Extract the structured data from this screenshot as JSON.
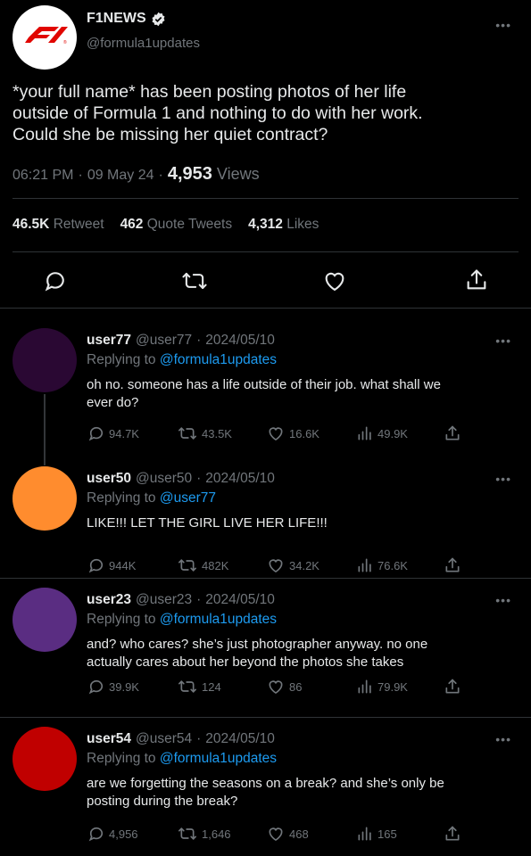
{
  "tweet": {
    "account_name": "F1NEWS",
    "handle": "@formula1updates",
    "text_line1": "*your full name* has been posting photos of her life",
    "text_line2": "outside of Formula 1 and nothing to do with her work.",
    "text_line3": "Could she be missing her quiet contract?",
    "time": "06:21 PM",
    "date": "09 May 24",
    "views_count": "4,953",
    "views_label": "Views",
    "retweets_count": "46.5K",
    "retweets_label": "Retweet",
    "quotes_count": "462",
    "quotes_label": "Quote Tweets",
    "likes_count": "4,312",
    "likes_label": "Likes",
    "sep": "·"
  },
  "replying_to_label": "Replying to",
  "replies": [
    {
      "username": "user77",
      "handle": "@user77",
      "date": "2024/05/10",
      "reply_to": "@formula1updates",
      "text_line1": "oh no. someone has a life outside of their job. what shall we",
      "text_line2": "ever do?",
      "replies_count": "94.7K",
      "retweets_count": "43.5K",
      "likes_count": "16.6K",
      "views_count": "49.9K",
      "avatar_color": "#2a0833"
    },
    {
      "username": "user50",
      "handle": "@user50",
      "date": "2024/05/10",
      "reply_to": "@user77",
      "text_line1": "LIKE!!! LET THE GIRL LIVE HER LIFE!!!",
      "text_line2": "",
      "replies_count": "944K",
      "retweets_count": "482K",
      "likes_count": "34.2K",
      "views_count": "76.6K",
      "avatar_color": "#ff8c2e"
    },
    {
      "username": "user23",
      "handle": "@user23",
      "date": "2024/05/10",
      "reply_to": "@formula1updates",
      "text_line1": "and? who cares? she’s just photographer anyway. no one",
      "text_line2": "actually cares about her beyond the photos she takes",
      "replies_count": "39.9K",
      "retweets_count": "124",
      "likes_count": "86",
      "views_count": "79.9K",
      "avatar_color": "#5a2d82"
    },
    {
      "username": "user54",
      "handle": "@user54",
      "date": "2024/05/10",
      "reply_to": "@formula1updates",
      "text_line1": "are we forgetting the seasons on a break? and she’s only be",
      "text_line2": "posting during the break?",
      "replies_count": "4,956",
      "retweets_count": "1,646",
      "likes_count": "468",
      "views_count": "165",
      "avatar_color": "#c00000"
    }
  ],
  "colors": {
    "background": "#000000",
    "text": "#e7e9ea",
    "muted": "#71767b",
    "link": "#1d9bf0",
    "divider": "#2f3336",
    "brand_red": "#e10600"
  }
}
